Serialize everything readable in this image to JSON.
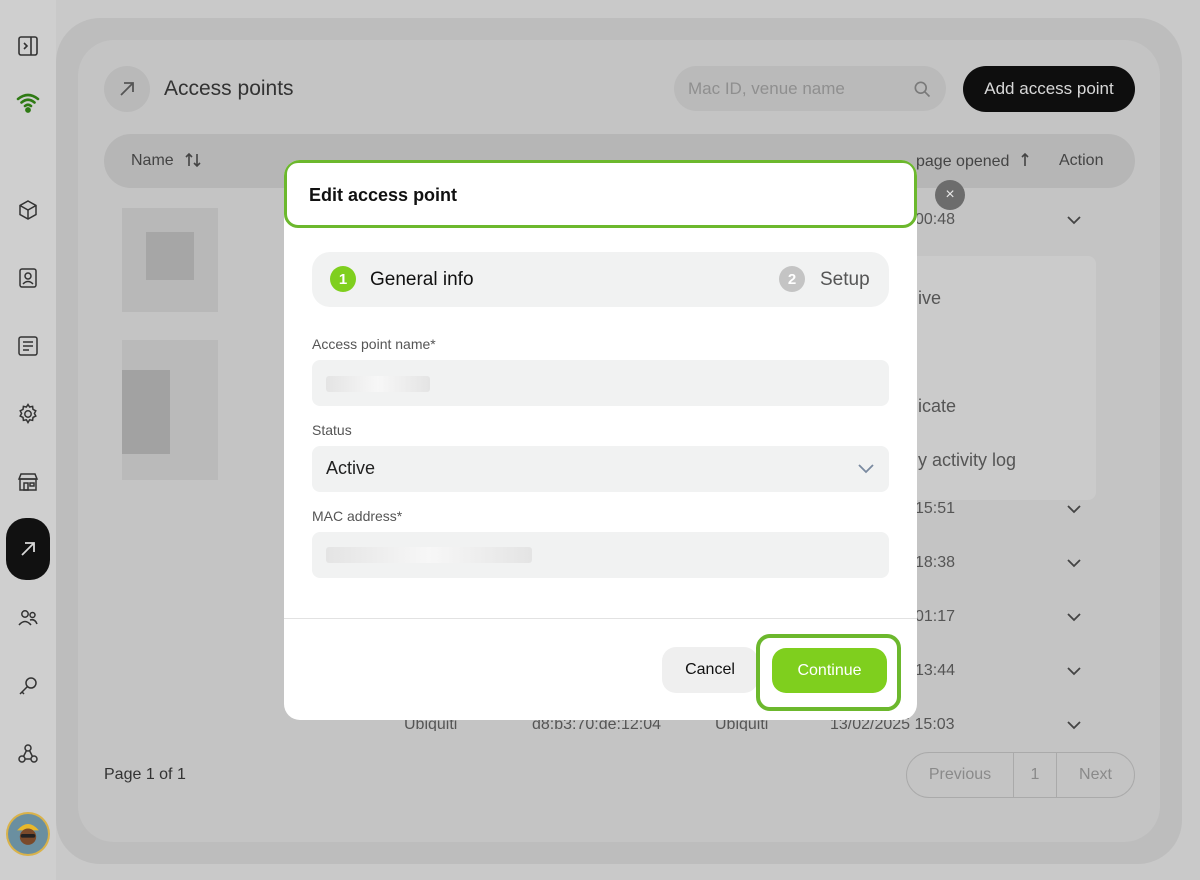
{
  "page": {
    "title": "Access points",
    "search_placeholder": "Mac ID, venue name",
    "add_button": "Add access point"
  },
  "table": {
    "headers": {
      "name": "Name",
      "last_opened": "page opened",
      "action": "Action"
    },
    "visible_times": [
      "00:48",
      "15:51",
      "18:38",
      "01:17",
      "13:44"
    ],
    "last_row": {
      "vendor": "Ubiquiti",
      "mac": "d8:b3:70:de:12:04",
      "type": "Ubiquiti",
      "last_opened": "13/02/2025 15:03"
    }
  },
  "dropdown_menu": {
    "items": [
      "ive",
      "icate",
      "y activity log"
    ]
  },
  "pagination": {
    "label": "Page 1 of 1",
    "previous": "Previous",
    "current": "1",
    "next": "Next"
  },
  "modal": {
    "title": "Edit access point",
    "close_icon": "×",
    "steps": [
      {
        "number": "1",
        "label": "General info",
        "active": true
      },
      {
        "number": "2",
        "label": "Setup",
        "active": false
      }
    ],
    "fields": {
      "name_label": "Access point name*",
      "status_label": "Status",
      "status_value": "Active",
      "mac_label": "MAC address*"
    },
    "cancel": "Cancel",
    "continue": "Continue"
  },
  "colors": {
    "accent_green": "#7fcf1e",
    "highlight_outline": "#6cb82d",
    "brand_wifi": "#3a7d0e"
  }
}
